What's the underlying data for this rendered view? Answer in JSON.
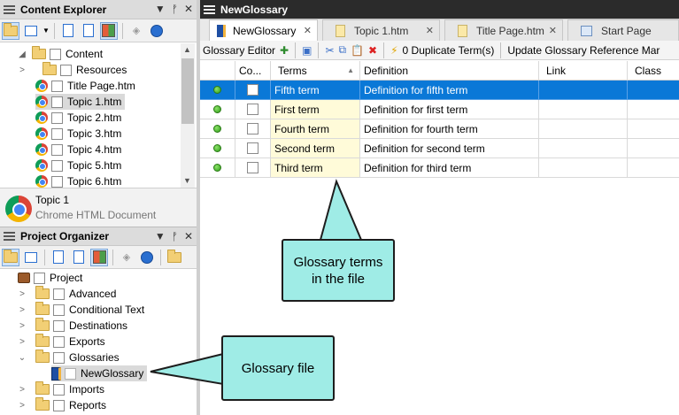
{
  "content_explorer": {
    "title": "Content Explorer",
    "tree": [
      {
        "label": "Content",
        "type": "folder-open",
        "expanded": true,
        "level": 0
      },
      {
        "label": "Resources",
        "type": "folder",
        "level": 1
      },
      {
        "label": "Title Page.htm",
        "type": "chrome",
        "level": 1
      },
      {
        "label": "Topic 1.htm",
        "type": "chrome",
        "level": 1,
        "selected": true
      },
      {
        "label": "Topic 2.htm",
        "type": "chrome",
        "level": 1
      },
      {
        "label": "Topic 3.htm",
        "type": "chrome",
        "level": 1
      },
      {
        "label": "Topic 4.htm",
        "type": "chrome",
        "level": 1
      },
      {
        "label": "Topic 5.htm",
        "type": "chrome",
        "level": 1
      },
      {
        "label": "Topic 6.htm",
        "type": "chrome",
        "level": 1
      }
    ],
    "info": {
      "name": "Topic 1",
      "type": "Chrome HTML Document"
    }
  },
  "project_organizer": {
    "title": "Project Organizer",
    "tree": [
      {
        "label": "Project",
        "type": "briefcase",
        "level": 0
      },
      {
        "label": "Advanced",
        "type": "folder",
        "level": 1
      },
      {
        "label": "Conditional Text",
        "type": "folder",
        "level": 1
      },
      {
        "label": "Destinations",
        "type": "folder",
        "level": 1
      },
      {
        "label": "Exports",
        "type": "folder",
        "level": 1
      },
      {
        "label": "Glossaries",
        "type": "folder-open",
        "level": 1,
        "expanded": true
      },
      {
        "label": "NewGlossary",
        "type": "book",
        "level": 2,
        "selected": true
      },
      {
        "label": "Imports",
        "type": "folder",
        "level": 1
      },
      {
        "label": "Reports",
        "type": "folder",
        "level": 1
      }
    ]
  },
  "editor": {
    "title": "NewGlossary",
    "tabs": [
      {
        "label": "NewGlossary",
        "active": true
      },
      {
        "label": "Topic 1.htm"
      },
      {
        "label": "Title Page.htm"
      },
      {
        "label": "Start Page"
      }
    ],
    "toolbar": {
      "label": "Glossary Editor",
      "duplicate": "0 Duplicate Term(s)",
      "update": "Update Glossary Reference Mar"
    },
    "columns": [
      "",
      "Co...",
      "Terms",
      "Definition",
      "Link",
      "Class"
    ],
    "rows": [
      {
        "term": "Fifth term",
        "definition": "Definition for fifth term",
        "selected": true
      },
      {
        "term": "First term",
        "definition": "Definition for first term"
      },
      {
        "term": "Fourth term",
        "definition": "Definition for fourth term"
      },
      {
        "term": "Second term",
        "definition": "Definition for second term"
      },
      {
        "term": "Third term",
        "definition": "Definition for third term"
      }
    ]
  },
  "callouts": {
    "terms": "Glossary terms in the file",
    "file": "Glossary file"
  },
  "colors": {
    "selection": "#0a78d7",
    "callout": "#9fece6",
    "terms_highlight": "#fffbd9"
  }
}
